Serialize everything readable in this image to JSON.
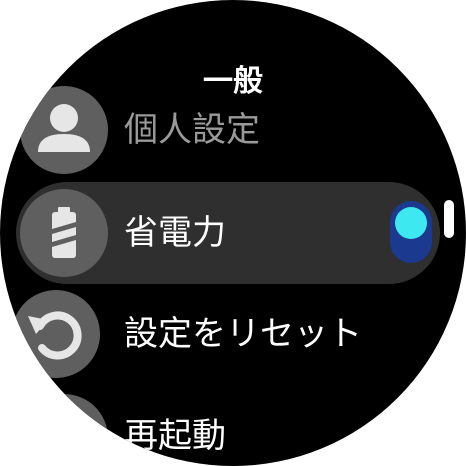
{
  "header": {
    "title": "一般"
  },
  "menu": {
    "items": [
      {
        "label": "個人設定",
        "icon": "person-icon"
      },
      {
        "label": "省電力",
        "icon": "battery-icon",
        "toggle_on": true
      },
      {
        "label": "設定をリセット",
        "icon": "reset-icon"
      },
      {
        "label": "再起動",
        "icon": "restart-icon"
      }
    ]
  },
  "colors": {
    "background": "#000000",
    "row_highlight": "#2f2f2f",
    "icon_circle": "#5f5f5f",
    "toggle_track": "#1b3a8f",
    "toggle_knob": "#3de8f0"
  }
}
